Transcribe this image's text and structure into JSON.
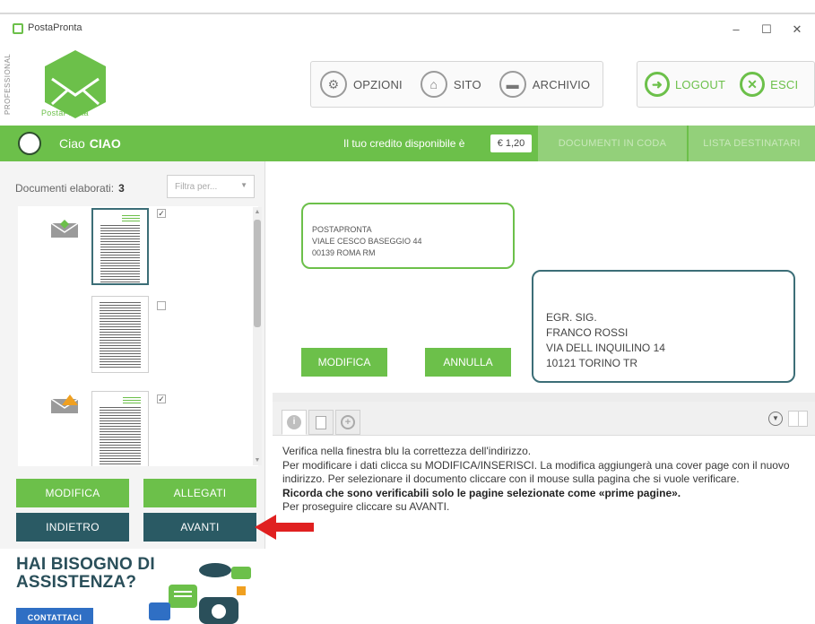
{
  "window": {
    "title": "PostaPronta",
    "minimize": "–",
    "maximize": "☐",
    "close": "✕"
  },
  "header": {
    "edition": "PROFESSIONAL",
    "logo_text": "PostaPronta",
    "toolbar": [
      {
        "label": "OPZIONI",
        "icon": "gear-icon"
      },
      {
        "label": "SITO",
        "icon": "home-icon"
      },
      {
        "label": "ARCHIVIO",
        "icon": "archive-icon"
      }
    ],
    "toolbar_right": [
      {
        "label": "LOGOUT",
        "icon": "logout-icon"
      },
      {
        "label": "ESCI",
        "icon": "close-circle-icon"
      }
    ]
  },
  "greenbar": {
    "greeting": "Ciao",
    "username": "CIAO",
    "credit_label": "Il tuo credito disponibile è",
    "credit_value": "€ 1,20",
    "tab_queue": "DOCUMENTI IN CODA",
    "tab_recipients": "LISTA DESTINATARI"
  },
  "left": {
    "processed_label": "Documenti elaborati:",
    "processed_count": "3",
    "filter_placeholder": "Filtra per...",
    "check_mark": "✓",
    "buttons": {
      "modifica": "MODIFICA",
      "allegati": "ALLEGATI",
      "indietro": "INDIETRO",
      "avanti": "AVANTI"
    },
    "ad": {
      "title_line1": "HAI BISOGNO DI",
      "title_line2": "ASSISTENZA?",
      "button": "CONTATTACI"
    }
  },
  "preview": {
    "sender": [
      "POSTAPRONTA",
      "VIALE CESCO BASEGGIO 44",
      "00139 ROMA RM"
    ],
    "recipient": [
      "EGR. SIG.",
      "FRANCO ROSSI",
      "VIA DELL INQUILINO 14",
      "10121 TORINO TR"
    ],
    "btn_modifica": "MODIFICA",
    "btn_annulla": "ANNULLA"
  },
  "info": {
    "tabs": [
      "info-icon",
      "document-icon",
      "add-icon"
    ],
    "line1": "Verifica nella finestra blu la correttezza dell'indirizzo.",
    "line2": "Per modificare i dati clicca su MODIFICA/INSERISCI. La modifica aggiungerà una cover page con il nuovo indirizzo. Per selezionare il documento cliccare con il mouse sulla pagina che si vuole verificare.",
    "line3": "Ricorda che sono verificabili solo le pagine selezionate come «prime pagine».",
    "line4": "Per proseguire cliccare su AVANTI."
  },
  "colors": {
    "brand_green": "#6cc04a",
    "dark_teal": "#2a5a64",
    "arrow_red": "#e02020"
  }
}
